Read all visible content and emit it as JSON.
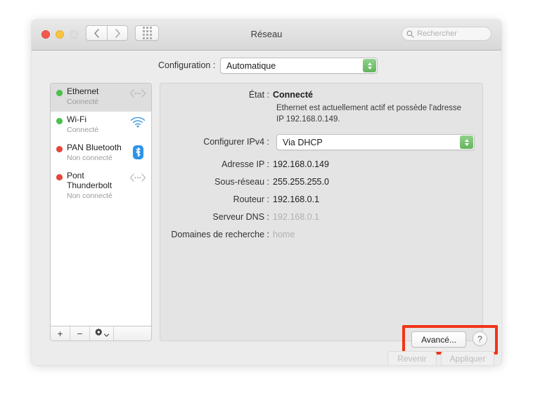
{
  "window": {
    "title": "Réseau",
    "traffic_lights": [
      "close",
      "minimize",
      "zoom"
    ],
    "nav": {
      "back": "back-arrow",
      "forward": "forward-arrow",
      "show_all": "grid-icon"
    },
    "search": {
      "placeholder": "Rechercher",
      "value": "",
      "icon": "search-icon"
    }
  },
  "config": {
    "label": "Configuration :",
    "value": "Automatique"
  },
  "sidebar": {
    "items": [
      {
        "name": "Ethernet",
        "status": "Connecté",
        "led": "green",
        "icon": "ethernet-icon",
        "selected": true
      },
      {
        "name": "Wi-Fi",
        "status": "Connecté",
        "led": "green",
        "icon": "wifi-icon",
        "selected": false
      },
      {
        "name": "PAN Bluetooth",
        "status": "Non connecté",
        "led": "red",
        "icon": "bluetooth-icon",
        "selected": false
      },
      {
        "name": "Pont Thunderbolt",
        "status": "Non connecté",
        "led": "red",
        "icon": "thunderbolt-bridge-icon",
        "selected": false
      }
    ],
    "toolbar": {
      "add": "+",
      "remove": "−",
      "action": "gear-icon"
    }
  },
  "panel": {
    "state_label": "État :",
    "state_value": "Connecté",
    "state_description": "Ethernet est actuellement actif et possède l'adresse IP 192.168.0.149.",
    "ipv4_label": "Configurer IPv4 :",
    "ipv4_value": "Via DHCP",
    "rows": [
      {
        "label": "Adresse IP :",
        "value": "192.168.0.149",
        "dim": false
      },
      {
        "label": "Sous-réseau :",
        "value": "255.255.255.0",
        "dim": false
      },
      {
        "label": "Routeur :",
        "value": "192.168.0.1",
        "dim": false
      },
      {
        "label": "Serveur DNS :",
        "value": "192.168.0.1",
        "dim": true
      },
      {
        "label": "Domaines de recherche :",
        "value": "home",
        "dim": true
      }
    ]
  },
  "buttons": {
    "advanced": "Avancé...",
    "help": "?",
    "revert": "Revenir",
    "apply": "Appliquer"
  },
  "annotation": {
    "highlight_color": "#f03418"
  }
}
